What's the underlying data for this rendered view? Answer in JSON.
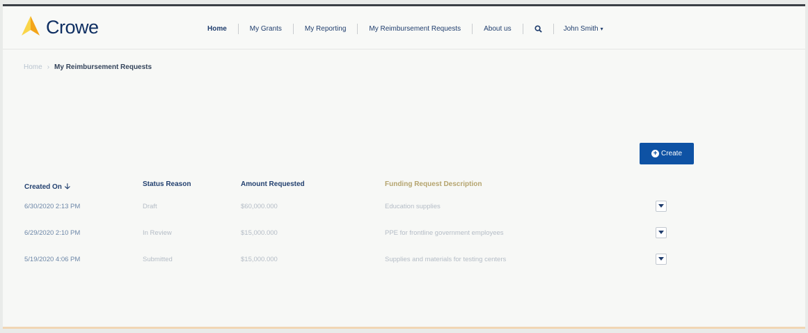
{
  "header": {
    "logo_text": "Crowe",
    "nav": [
      {
        "label": "Home"
      },
      {
        "label": "My Grants"
      },
      {
        "label": "My Reporting"
      },
      {
        "label": "My Reimbursement Requests"
      },
      {
        "label": "About us"
      }
    ],
    "user": "John Smith"
  },
  "breadcrumb": {
    "home": "Home",
    "current": "My Reimbursement Requests"
  },
  "create_label": "Create",
  "table": {
    "columns": [
      "Created On",
      "Status Reason",
      "Amount Requested",
      "Funding Request Description"
    ],
    "rows": [
      {
        "created": "6/30/2020 2:13 PM",
        "status": "Draft",
        "amount": "$60,000.000",
        "description": "Education supplies"
      },
      {
        "created": "6/29/2020 2:10 PM",
        "status": "In Review",
        "amount": "$15,000.000",
        "description": "PPE for frontline government employees"
      },
      {
        "created": "5/19/2020 4:06 PM",
        "status": "Submitted",
        "amount": "$15,000.000",
        "description": "Supplies and materials for testing centers"
      }
    ]
  },
  "colors": {
    "brand_navy": "#0f2f62",
    "logo_yellow": "#f6b51c",
    "button_blue": "#0e52a4",
    "link_blue": "#6d87a8"
  },
  "icons": {
    "search": "search-icon",
    "sort": "arrow-down-icon",
    "create": "plus-circle-icon",
    "row_menu": "chevron-down-icon"
  }
}
